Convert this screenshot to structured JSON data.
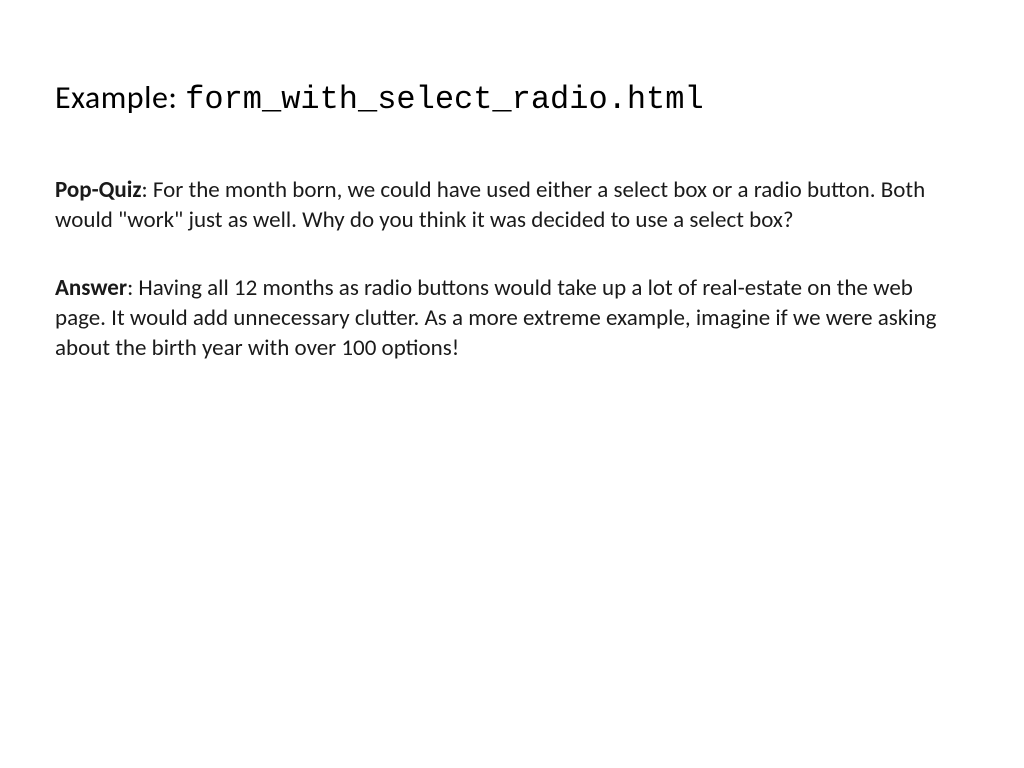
{
  "heading": {
    "label": "Example: ",
    "filename": "form_with_select_radio.html"
  },
  "quiz": {
    "label": "Pop-Quiz",
    "text": ": For the month born, we could have used either a select box or a radio button. Both would \"work\" just as well. Why do you think it was decided to use a select box?"
  },
  "answer": {
    "label": "Answer",
    "text": ": Having all 12 months as radio buttons would take up a lot of real-estate on the web page. It would add unnecessary clutter.  As a more extreme example, imagine if we were asking about the birth year with over 100 options!"
  }
}
